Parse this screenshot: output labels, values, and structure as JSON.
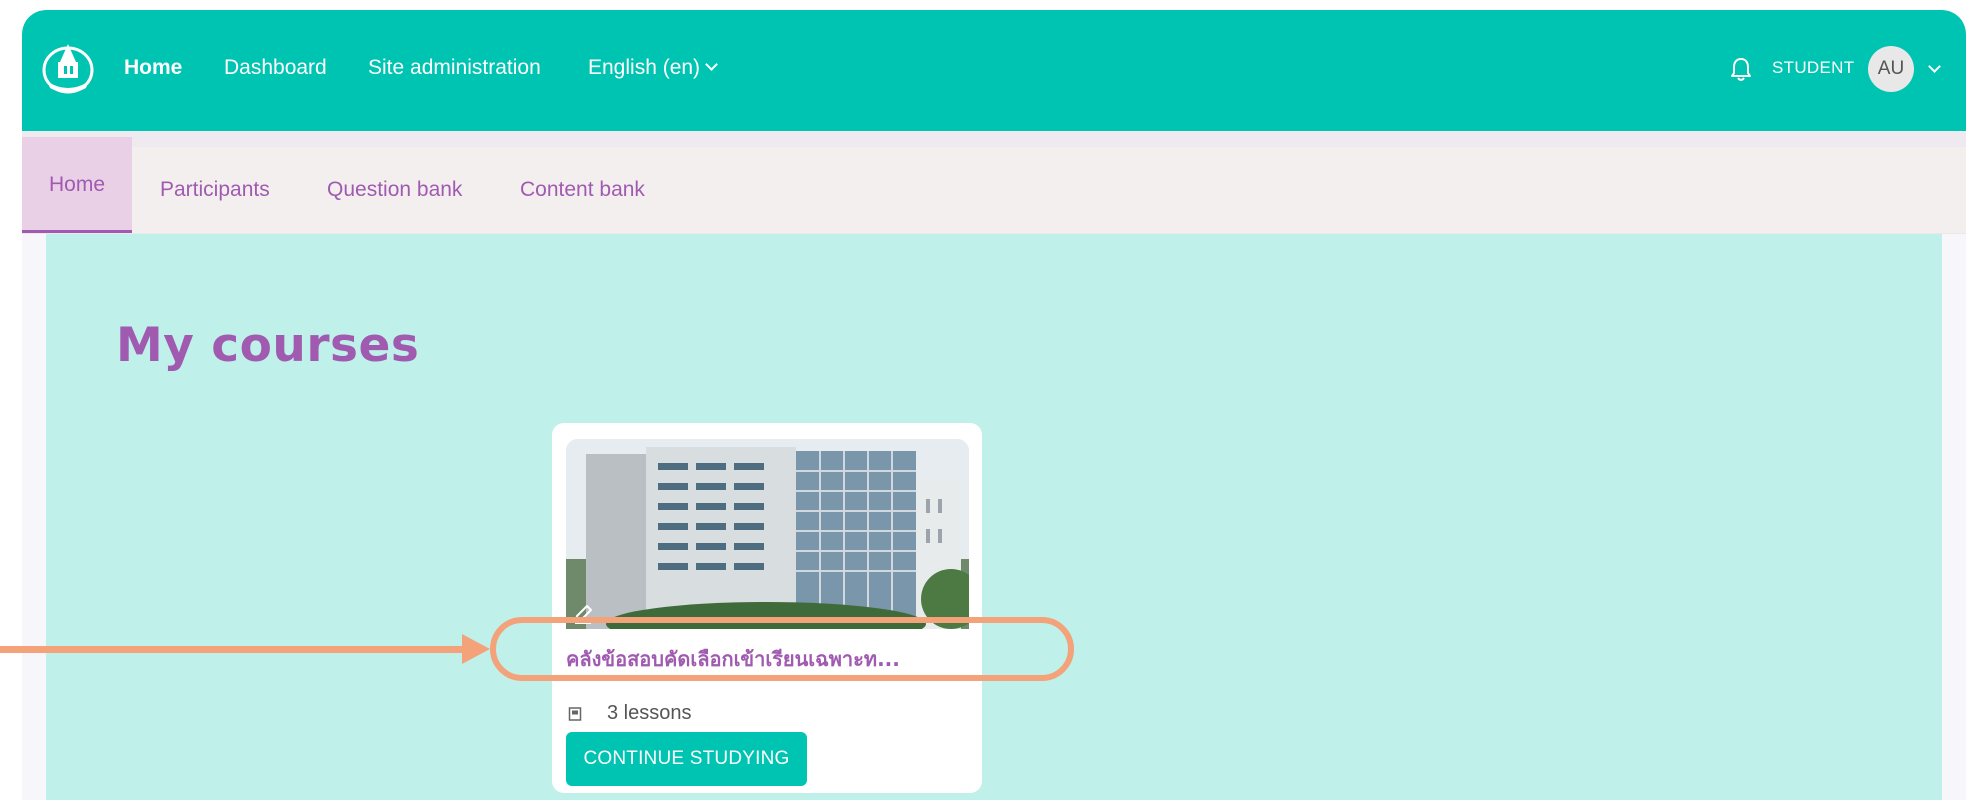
{
  "header": {
    "nav": [
      {
        "label": "Home"
      },
      {
        "label": "Dashboard"
      },
      {
        "label": "Site administration"
      },
      {
        "label": "English (en)"
      }
    ],
    "role_label": "STUDENT",
    "avatar_initials": "AU"
  },
  "secondary_nav": {
    "tabs": [
      {
        "label": "Home"
      },
      {
        "label": "Participants"
      },
      {
        "label": "Question bank"
      },
      {
        "label": "Content bank"
      }
    ]
  },
  "main": {
    "title": "My courses",
    "course": {
      "name": "คลังข้อสอบคัดเลือกเข้าเรียนเฉพาะท...",
      "lessons": "3 lessons",
      "continue_label": "CONTINUE STUDYING"
    }
  },
  "colors": {
    "primary": "#00c4b2",
    "accent": "#a05bb0",
    "content_bg": "#bff0ea",
    "annotation": "#f4a27a"
  },
  "icons": {
    "logo": "university-seal-logo",
    "notifications": "bell-icon",
    "edit": "pencil-icon",
    "lessons": "book-icon"
  }
}
